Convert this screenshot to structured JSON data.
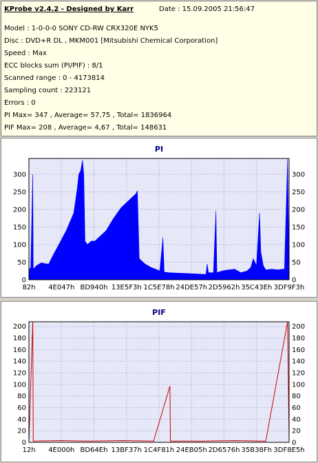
{
  "info": {
    "title": "KProbe v2.4.2 - Designed by Karr",
    "date": "Date : 15.09.2005 21:56:47",
    "lines": [
      "Model : 1-0-0-0 SONY     CD-RW  CRX320E   NYK5",
      "Disc : DVD+R DL , MKM001 [Mitsubishi Chemical Corporation]",
      "Speed : Max",
      "ECC blocks sum (PI/PIF) : 8/1",
      "Scanned range : 0 - 4173814",
      "Sampling count : 223121",
      "Errors : 0",
      "PI Max= 347 , Average= 57,75 , Total= 1836964",
      "PIF Max= 208 , Average= 4,67 , Total= 148631"
    ]
  },
  "colors": {
    "pi_fill": "#0000ff",
    "pif_line": "#cc0000",
    "plot_bg": "#e6e8f8",
    "grid": "#a0a0d0",
    "title": "#000080"
  },
  "chart_data": [
    {
      "type": "area",
      "title": "PI",
      "x_tick_labels": [
        "82h",
        "4E047h",
        "BD940h",
        "13E5F3h",
        "1C5E78h",
        "24DE57h",
        "2D5962h",
        "35C43Eh",
        "3DF9F3h"
      ],
      "y_tick_labels": [
        "0",
        "50",
        "100",
        "150",
        "200",
        "250",
        "300"
      ],
      "ylim": [
        0,
        345
      ],
      "xlim": [
        0,
        4173814
      ],
      "grid": true,
      "series": [
        {
          "points": [
            [
              0,
              28
            ],
            [
              30000,
              35
            ],
            [
              62000,
              300
            ],
            [
              70000,
              30
            ],
            [
              120000,
              40
            ],
            [
              200000,
              48
            ],
            [
              280000,
              45
            ],
            [
              319559,
              45
            ],
            [
              360000,
              60
            ],
            [
              420000,
              80
            ],
            [
              480000,
              100
            ],
            [
              540000,
              120
            ],
            [
              600000,
              140
            ],
            [
              660000,
              165
            ],
            [
              720000,
              190
            ],
            [
              776512,
              260
            ],
            [
              800000,
              300
            ],
            [
              830000,
              310
            ],
            [
              860000,
              340
            ],
            [
              880000,
              300
            ],
            [
              900000,
              110
            ],
            [
              940000,
              100
            ],
            [
              1000000,
              110
            ],
            [
              1060000,
              110
            ],
            [
              1120000,
              120
            ],
            [
              1180000,
              130
            ],
            [
              1240000,
              140
            ],
            [
              1307123,
              160
            ],
            [
              1360000,
              175
            ],
            [
              1420000,
              190
            ],
            [
              1480000,
              205
            ],
            [
              1540000,
              215
            ],
            [
              1600000,
              225
            ],
            [
              1660000,
              235
            ],
            [
              1719000,
              245
            ],
            [
              1740000,
              253
            ],
            [
              1770000,
              60
            ],
            [
              1860000,
              45
            ],
            [
              1960000,
              35
            ],
            [
              2060000,
              28
            ],
            [
              2100000,
              25
            ],
            [
              2150000,
              120
            ],
            [
              2170000,
              22
            ],
            [
              2256000,
              20
            ],
            [
              2500000,
              18
            ],
            [
              2745000,
              16
            ],
            [
              2840000,
              15
            ],
            [
              2860000,
              45
            ],
            [
              2880000,
              20
            ],
            [
              2960000,
              20
            ],
            [
              3000000,
              195
            ],
            [
              3015000,
              20
            ],
            [
              3100000,
              25
            ],
            [
              3200000,
              28
            ],
            [
              3300000,
              30
            ],
            [
              3400000,
              20
            ],
            [
              3500000,
              25
            ],
            [
              3560000,
              35
            ],
            [
              3600000,
              60
            ],
            [
              3650000,
              40
            ],
            [
              3700000,
              190
            ],
            [
              3720000,
              80
            ],
            [
              3760000,
              40
            ],
            [
              3800000,
              28
            ],
            [
              3900000,
              30
            ],
            [
              4000000,
              28
            ],
            [
              4060000,
              30
            ],
            [
              4100000,
              30
            ],
            [
              4150000,
              345
            ],
            [
              4173814,
              30
            ]
          ]
        }
      ]
    },
    {
      "type": "line",
      "title": "PIF",
      "x_tick_labels": [
        "12h",
        "4E000h",
        "BD64Eh",
        "13BF37h",
        "1C4F81h",
        "24EB05h",
        "2D6576h",
        "35B38Fh",
        "3DF8E5h"
      ],
      "y_tick_labels": [
        "0",
        "20",
        "40",
        "60",
        "80",
        "100",
        "120",
        "140",
        "160",
        "180",
        "200"
      ],
      "ylim": [
        0,
        208
      ],
      "xlim": [
        0,
        4173814
      ],
      "grid": true,
      "series": [
        {
          "points": [
            [
              0,
              2
            ],
            [
              62000,
              208
            ],
            [
              70000,
              2
            ],
            [
              500000,
              3
            ],
            [
              1000000,
              2
            ],
            [
              1500000,
              3
            ],
            [
              2000000,
              2
            ],
            [
              2262000,
              97
            ],
            [
              2270000,
              2
            ],
            [
              2800000,
              2
            ],
            [
              3300000,
              3
            ],
            [
              3800000,
              2
            ],
            [
              4150000,
              208
            ],
            [
              4173814,
              2
            ]
          ]
        }
      ]
    }
  ]
}
